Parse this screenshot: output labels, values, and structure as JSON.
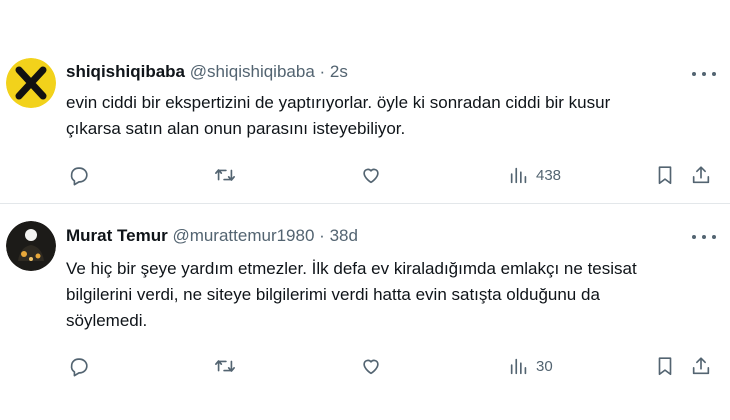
{
  "tweets": [
    {
      "author_name": "shiqishiqibaba",
      "author_handle": "@shiqishiqibaba",
      "separator": "·",
      "time": "2s",
      "text_lines": [
        "evin ciddi bir ekspertizini de yaptırıyorlar. öyle ki sonradan ciddi bir kusur",
        "çıkarsa satın alan onun parasını isteyebiliyor."
      ],
      "views": "438",
      "avatar_colors": {
        "bg": "#f2d21b",
        "mark": "#111111"
      }
    },
    {
      "author_name": "Murat Temur",
      "author_handle": "@murattemur1980",
      "separator": "·",
      "time": "38d",
      "text_lines": [
        "Ve hiç bir şeye yardım etmezler. İlk defa ev kiraladığımda emlakçı ne tesisat",
        "bilgilerini verdi, ne siteye bilgilerimi verdi hatta evin satışta olduğunu da",
        "söylemedi."
      ],
      "views": "30",
      "avatar_colors": {
        "bg": "#1c1b18",
        "accent": "#e8a83a"
      }
    }
  ],
  "icons": {
    "reply": "reply-icon",
    "retweet": "retweet-icon",
    "like": "like-icon",
    "views": "views-icon",
    "bookmark": "bookmark-icon",
    "share": "share-icon",
    "more": "more-icon"
  },
  "colors": {
    "text": "#0f1419",
    "secondary": "#536471",
    "divider": "#e3e7ea"
  }
}
